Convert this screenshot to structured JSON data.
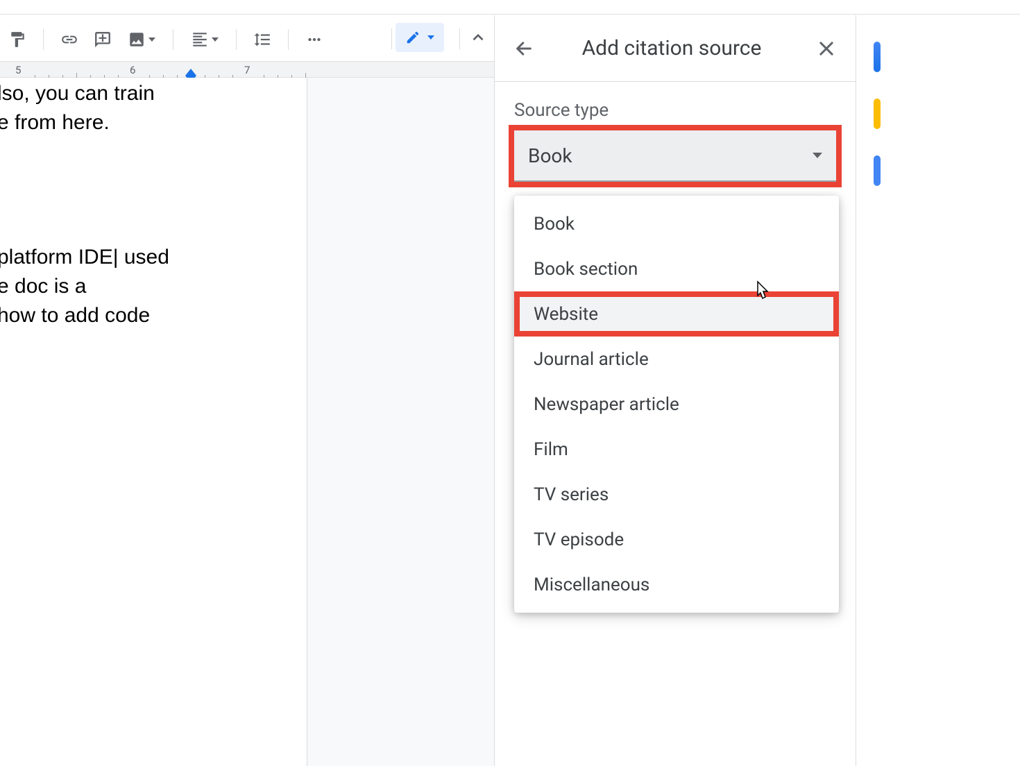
{
  "toolbar": {
    "items": [
      "paint-format",
      "insert-link",
      "add-comment",
      "insert-image",
      "align",
      "line-spacing",
      "more"
    ],
    "mode_label": "Editing"
  },
  "ruler": {
    "numbers": [
      5,
      6,
      7
    ]
  },
  "document": {
    "line_a_top": "lso, you can train",
    "line_a_bot": "e from here.",
    "line_b_1": "platform IDE| used",
    "line_b_2": "e doc is a",
    "line_b_3": "how to add code"
  },
  "citation_panel": {
    "title": "Add citation source",
    "field_label": "Source type",
    "selected": "Book",
    "options": [
      "Book",
      "Book section",
      "Website",
      "Journal article",
      "Newspaper article",
      "Film",
      "TV series",
      "TV episode",
      "Miscellaneous"
    ],
    "hovered_index": 2,
    "highlight_select": true,
    "highlight_option_index": 2
  },
  "colors": {
    "highlight": "#ea4335",
    "accent": "#1a73e8"
  }
}
